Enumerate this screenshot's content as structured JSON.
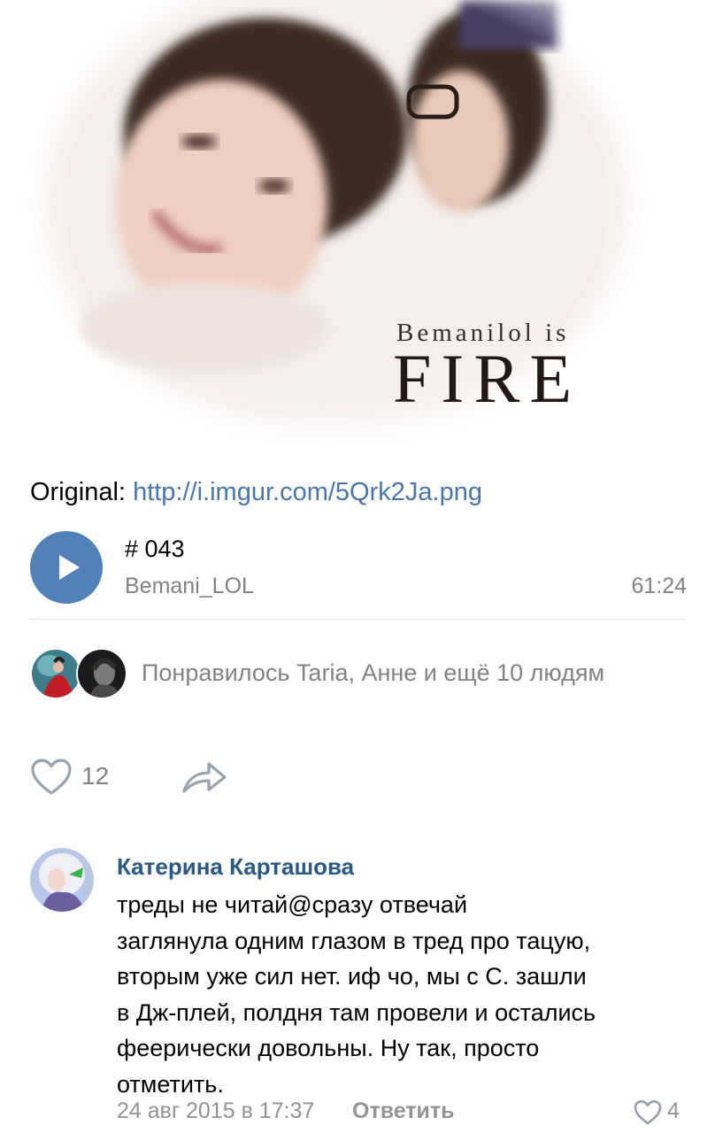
{
  "cover": {
    "title_small": "Bemanilol is",
    "title_big": "FIRE"
  },
  "post": {
    "original_label": "Original:",
    "original_link": "http://i.imgur.com/5Qrk2Ja.png"
  },
  "audio": {
    "title": "# 043",
    "artist": "Bemani_LOL",
    "duration": "61:24"
  },
  "likes": {
    "text": "Понравилось Taria, Анне и ещё 10 людям",
    "count": "12"
  },
  "comment": {
    "author": "Катерина Карташова",
    "text": "треды не читай@сразу отвечай\nзаглянула одним глазом в тред про тацую,\nвторым уже сил нет. иф чо, мы с С. зашли\nв Дж-плей, полдня там провели и остались\nфеерически довольны. Ну так, просто\nотметить.",
    "date": "24 авг 2015 в 17:37",
    "reply_label": "Ответить",
    "like_count": "4"
  },
  "colors": {
    "accent": "#5181b8",
    "link": "#4a76a8",
    "author": "#2a5885",
    "muted": "#828282"
  }
}
